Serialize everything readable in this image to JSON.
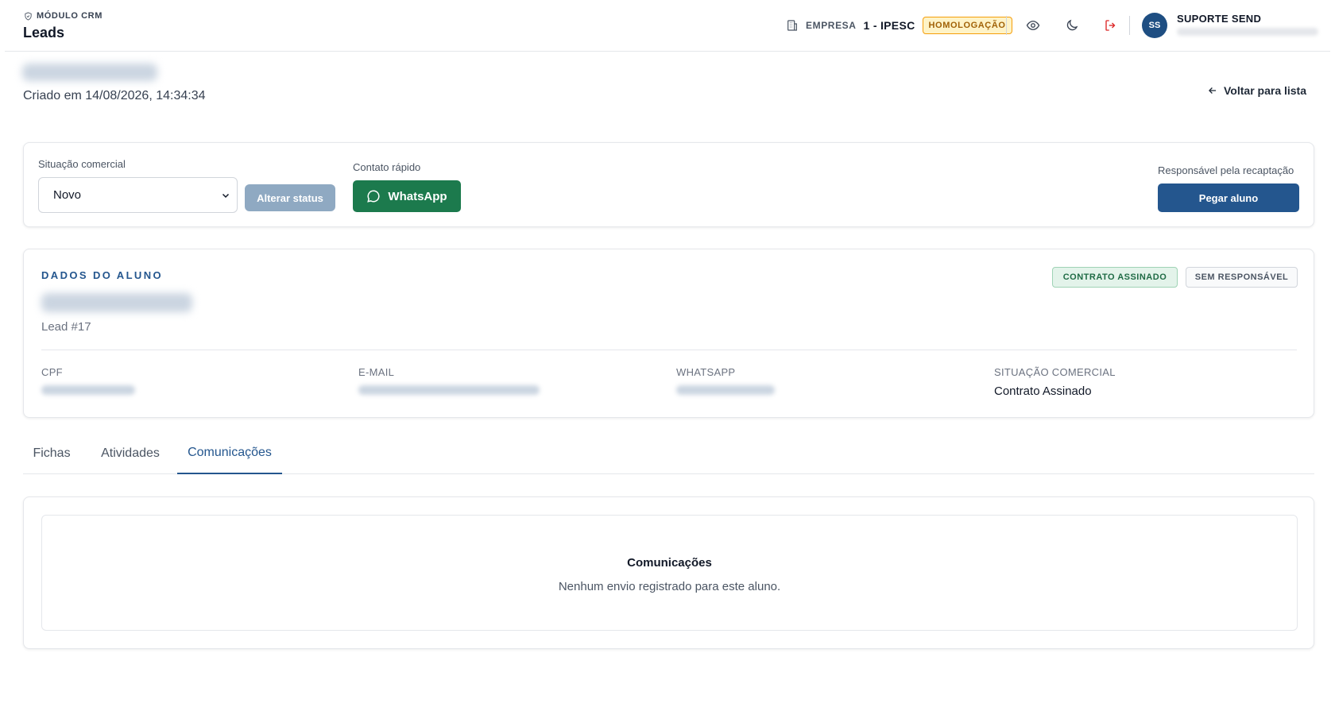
{
  "header": {
    "module_label": "MÓDULO CRM",
    "page_title": "Leads",
    "company_label": "EMPRESA",
    "company_value": "1 - IPESC",
    "environment_badge": "HOMOLOGAÇÃO",
    "user_initials": "SS",
    "user_name": "SUPORTE SEND"
  },
  "lead": {
    "created_at": "Criado em 14/08/2026, 14:34:34",
    "back_link": "Voltar para lista"
  },
  "actions": {
    "status_label": "Situação comercial",
    "status_value": "Novo",
    "change_status_button": "Alterar status",
    "quick_contact_label": "Contato rápido",
    "whatsapp_button": "WhatsApp",
    "responsible_label": "Responsável pela recaptação",
    "take_student_button": "Pegar aluno"
  },
  "student": {
    "section_title": "DADOS DO ALUNO",
    "lead_id": "Lead #17",
    "tags": [
      "CONTRATO ASSINADO",
      "SEM RESPONSÁVEL"
    ],
    "fields": {
      "cpf_label": "CPF",
      "email_label": "E-MAIL",
      "whatsapp_label": "WHATSAPP",
      "status_label": "SITUAÇÃO COMERCIAL",
      "status_value": "Contrato Assinado"
    }
  },
  "tabs": [
    {
      "label": "Fichas"
    },
    {
      "label": "Atividades"
    },
    {
      "label": "Comunicações"
    }
  ],
  "communications": {
    "title": "Comunicações",
    "empty_message": "Nenhum envio registrado para este aluno."
  },
  "colors": {
    "primary": "#24568e",
    "whatsapp": "#1c7a4d",
    "warning_badge": "#a16207",
    "success_tag": "#1f6b45"
  }
}
